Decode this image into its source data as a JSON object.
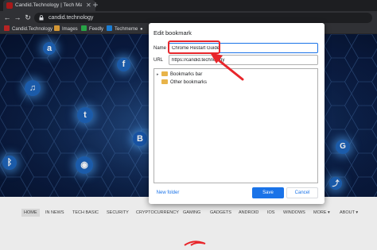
{
  "browser": {
    "tab_title": "Candid.Technology | Tech Made",
    "tab_close": "✕",
    "new_tab": "+",
    "url": "candid.technology"
  },
  "bookmarks_bar": {
    "items": [
      {
        "label": "Candid.Technology",
        "color": "#c62828"
      },
      {
        "label": "Images",
        "color": "#e6a43a"
      },
      {
        "label": "Feedly",
        "color": "#2bb24c"
      },
      {
        "label": "Techmeme",
        "color": "#1e88e5"
      }
    ]
  },
  "hero": {
    "icons": [
      {
        "name": "amazon-icon",
        "glyph": "a"
      },
      {
        "name": "facebook-icon",
        "glyph": "f"
      },
      {
        "name": "headphones-icon",
        "glyph": "♫"
      },
      {
        "name": "twitter-icon",
        "glyph": "t"
      },
      {
        "name": "bitcoin-icon",
        "glyph": "B"
      },
      {
        "name": "bluetooth-icon",
        "glyph": "ᛒ"
      },
      {
        "name": "camera-icon",
        "glyph": "◉"
      },
      {
        "name": "google-icon",
        "glyph": "G"
      },
      {
        "name": "share-icon",
        "glyph": "⤴"
      }
    ]
  },
  "site_nav": {
    "items": [
      "HOME",
      "IN NEWS",
      "TECH BASIC",
      "SECURITY",
      "CRYPTOCURRENCY",
      "GAMING",
      "GADGETS",
      "ANDROID",
      "IOS",
      "WINDOWS",
      "MORE ▾",
      "ABOUT ▾"
    ]
  },
  "dialog": {
    "title": "Edit bookmark",
    "name_label": "Name",
    "name_value": "Chrome Restart Guide",
    "url_label": "URL",
    "url_value": "https://candid.technology",
    "folders": [
      {
        "label": "Bookmarks bar",
        "expand": "▸"
      },
      {
        "label": "Other bookmarks",
        "expand": ""
      }
    ],
    "new_folder_label": "New folder",
    "save_label": "Save",
    "cancel_label": "Cancel"
  },
  "colors": {
    "accent": "#1a73e8",
    "annotation": "#e8262b",
    "chrome_dark": "#202124",
    "chrome_toolbar": "#35363a"
  }
}
